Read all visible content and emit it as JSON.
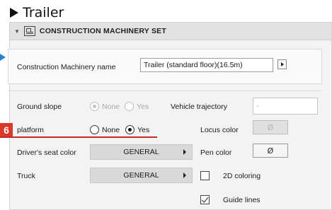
{
  "top_title": "Trailer",
  "panel": {
    "header_label": "CONSTRUCTION MACHINERY SET",
    "collapse_icon": "triangle-down-icon",
    "set_icon": "construction-set-icon"
  },
  "name_row": {
    "label": "Construction Machinery name",
    "value": "Trailer (standard floor)(16.5m)"
  },
  "ground_slope": {
    "label": "Ground slope",
    "options": [
      "None",
      "Yes"
    ],
    "selected": "None",
    "enabled": false
  },
  "vehicle_trajectory": {
    "label": "Vehicle trajectory",
    "value": "-"
  },
  "platform": {
    "label": "platform",
    "options": [
      "None",
      "Yes"
    ],
    "selected": "Yes"
  },
  "locus_color": {
    "label": "Locus color",
    "value": "Ø"
  },
  "drivers_seat_color": {
    "label": "Driver's seat color",
    "value": "GENERAL"
  },
  "pen_color": {
    "label": "Pen color",
    "value": "Ø"
  },
  "truck": {
    "label": "Truck",
    "value": "GENERAL"
  },
  "coloring_2d": {
    "label": "2D coloring",
    "checked": false
  },
  "guide_lines": {
    "label": "Guide lines",
    "checked": true
  },
  "step_badge": "6",
  "colors": {
    "badge": "#d9382a",
    "underline": "#c7282a",
    "pointer": "#2a7fd4",
    "header_bg": "#e2e2e2",
    "dropdown_bg": "#d9d9d9"
  }
}
